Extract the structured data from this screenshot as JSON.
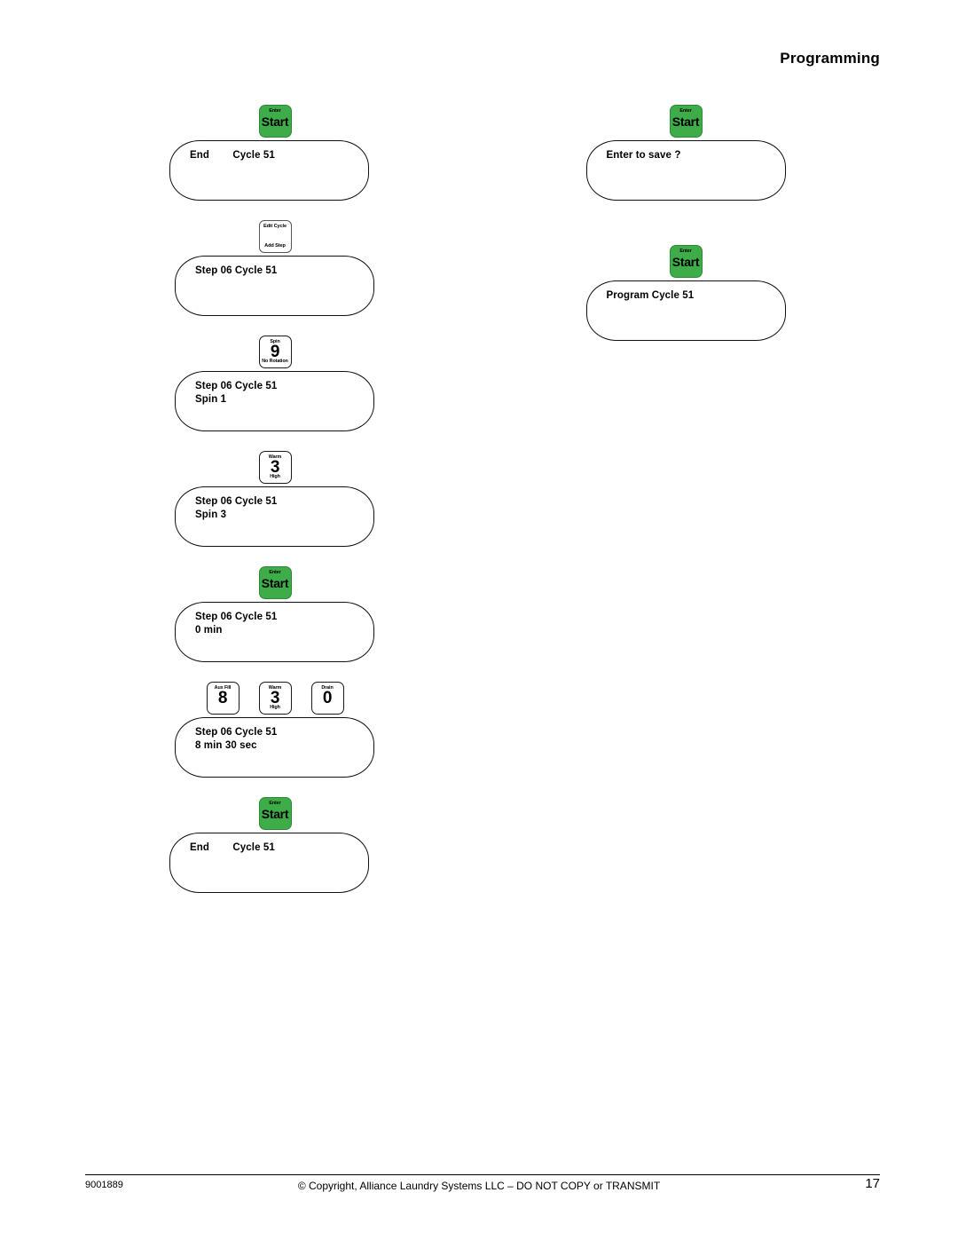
{
  "header": {
    "title": "Programming"
  },
  "keys": {
    "start": {
      "top_label": "Enter",
      "main_label": "Start",
      "bottom_label": ""
    },
    "edit_cycle": {
      "top_label": "Edit Cycle",
      "main_label": "",
      "bottom_label": "Add Step"
    },
    "nine_spin": {
      "top_label": "Spin",
      "main_label": "9",
      "bottom_label": "No Rotation"
    },
    "three_warm": {
      "top_label": "Warm",
      "main_label": "3",
      "bottom_label": "High"
    },
    "eight_aux_fill": {
      "top_label": "Aux Fill",
      "main_label": "8",
      "bottom_label": ""
    },
    "zero_drain": {
      "top_label": "Drain",
      "main_label": "0",
      "bottom_label": ""
    }
  },
  "left_column": {
    "steps": [
      {
        "key_row": [
          "start"
        ],
        "display_lines": [
          "End        Cycle 51"
        ],
        "indent": 1
      },
      {
        "key_row": [
          "edit_cycle"
        ],
        "display_lines": [
          "Step 06 Cycle 51"
        ],
        "indent": 2
      },
      {
        "key_row": [
          "nine_spin"
        ],
        "display_lines": [
          "Step 06 Cycle 51",
          "Spin 1"
        ],
        "indent": 2
      },
      {
        "key_row": [
          "three_warm"
        ],
        "display_lines": [
          "Step 06 Cycle 51",
          "Spin 3"
        ],
        "indent": 2
      },
      {
        "key_row": [
          "start"
        ],
        "display_lines": [
          "Step 06 Cycle 51",
          "0 min"
        ],
        "indent": 2
      },
      {
        "key_row": [
          "eight_aux_fill",
          "three_warm",
          "zero_drain"
        ],
        "display_lines": [
          "Step 06 Cycle 51",
          "8 min 30 sec"
        ],
        "indent": 2
      },
      {
        "key_row": [
          "start"
        ],
        "display_lines": [
          "End        Cycle 51"
        ],
        "indent": 1
      }
    ]
  },
  "right_column": {
    "steps": [
      {
        "key_row": [
          "start"
        ],
        "display_lines": [
          "Enter to save ?"
        ],
        "indent": 0
      },
      {
        "key_row": [
          "start"
        ],
        "display_lines": [
          "Program Cycle 51"
        ],
        "indent": 0
      }
    ]
  },
  "footer": {
    "document_number": "9001889",
    "copyright": "© Copyright, Alliance Laundry Systems LLC – DO NOT COPY or TRANSMIT",
    "page_number": "17"
  },
  "colors": {
    "start_key_green": "#3EAC48",
    "outline_black": "#111111"
  }
}
